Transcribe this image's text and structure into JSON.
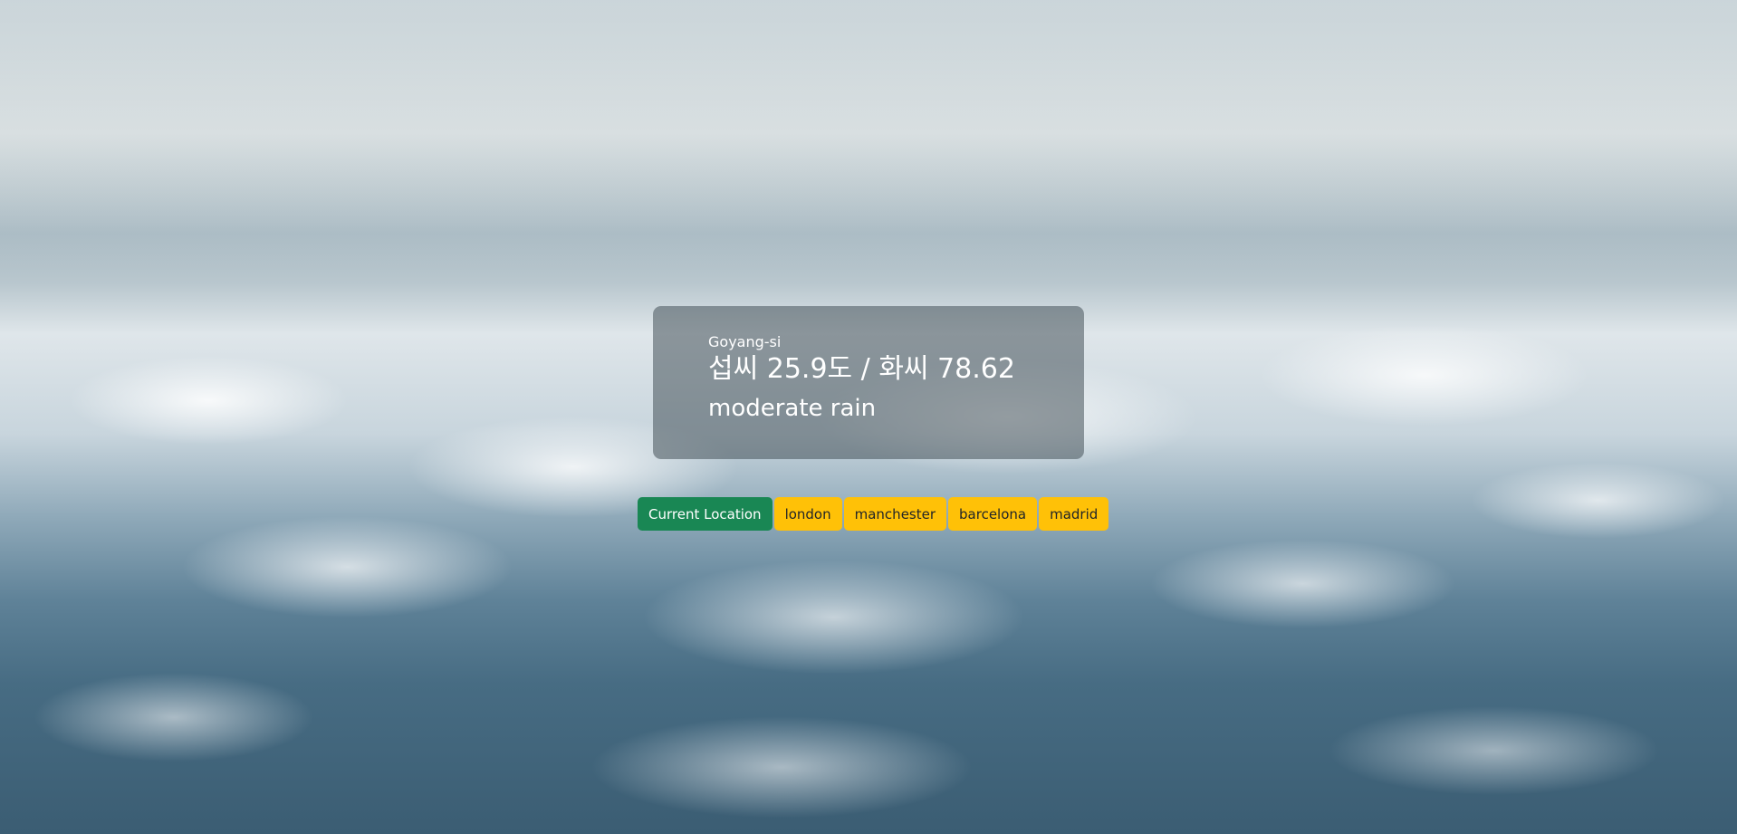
{
  "weather": {
    "city": "Goyang-si",
    "temperature_line": "섭씨 25.9도 / 화씨 78.62",
    "description": "moderate rain"
  },
  "buttons": {
    "current_location": "Current Location",
    "cities": [
      "london",
      "manchester",
      "barcelona",
      "madrid"
    ]
  },
  "colors": {
    "current_location_button": "#198754",
    "city_button": "#ffc107",
    "card_background": "rgba(70,82,90,0.55)"
  },
  "background": {
    "icon": "sky-clouds-background"
  }
}
